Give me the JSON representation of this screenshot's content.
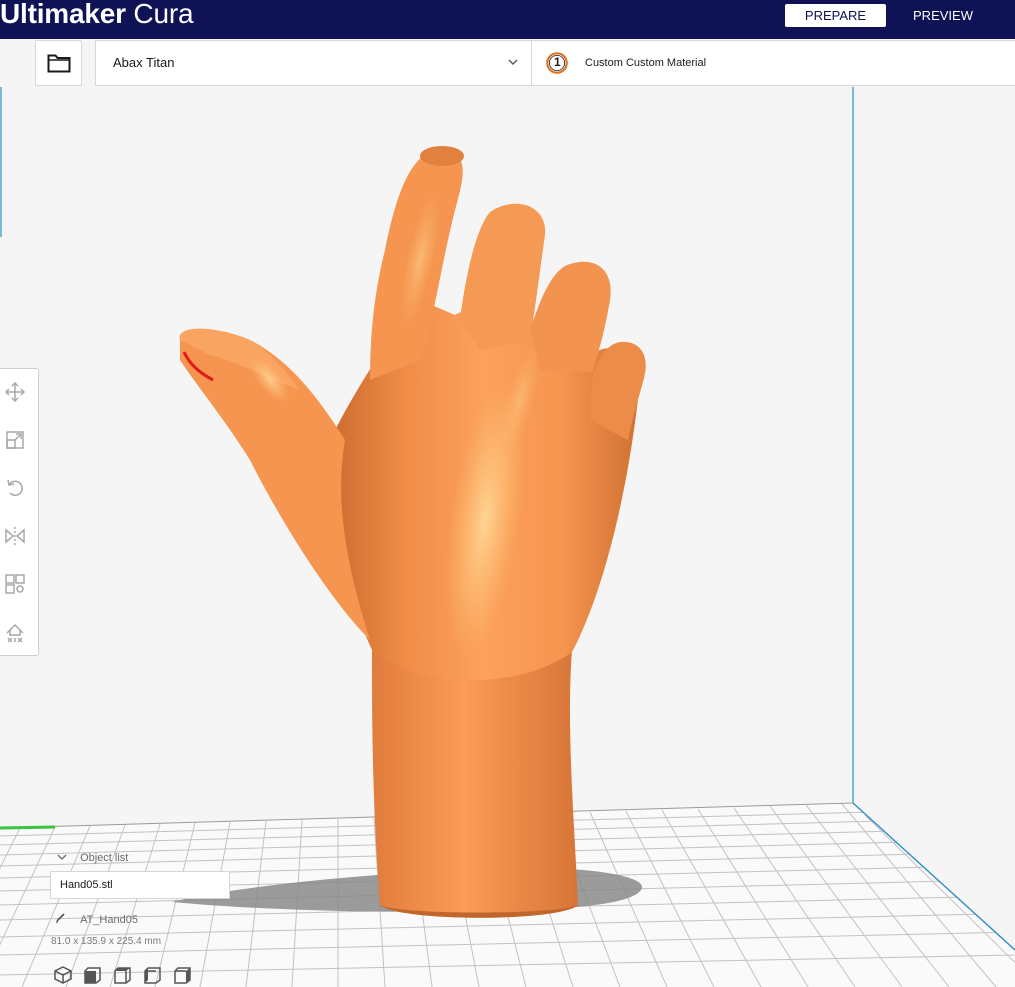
{
  "app": {
    "brand_bold": "Ultimaker",
    "brand_light": "Cura"
  },
  "stages": {
    "prepare": "PREPARE",
    "preview": "PREVIEW",
    "active": "prepare"
  },
  "toolbar": {
    "open_file_icon": "folder-icon",
    "printer": "Abax Titan",
    "extruder_number": "1",
    "material": "Custom Custom Material"
  },
  "tools": [
    {
      "name": "move",
      "icon": "move-icon"
    },
    {
      "name": "scale",
      "icon": "scale-icon"
    },
    {
      "name": "rotate",
      "icon": "rotate-icon"
    },
    {
      "name": "mirror",
      "icon": "mirror-icon"
    },
    {
      "name": "per-model-settings",
      "icon": "per-model-settings-icon"
    },
    {
      "name": "support-blocker",
      "icon": "support-blocker-icon"
    }
  ],
  "object_list": {
    "title": "Object list",
    "items": [
      "Hand05.stl"
    ],
    "selected_name": "AT_Hand05",
    "dimensions": "81.0 x 135.9 x 225.4 mm"
  },
  "view_buttons": [
    "3d-view-icon",
    "front-view-icon",
    "top-view-icon",
    "left-view-icon",
    "right-view-icon"
  ],
  "colors": {
    "header_bg": "#0f1254",
    "model_color": "#f7964d",
    "build_plate": "#ffffff",
    "grid_lines": "#c8c8c8",
    "accent_orange": "#e0701b"
  }
}
